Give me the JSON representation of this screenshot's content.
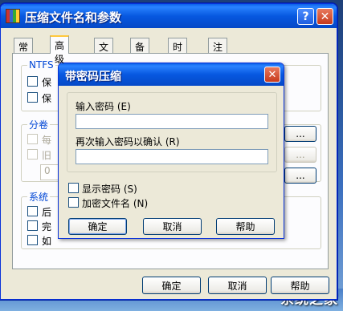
{
  "window": {
    "title": "压缩文件名和参数",
    "help_label": "?",
    "close_label": "✕"
  },
  "tabs": [
    "常规",
    "高级",
    "文件",
    "备份",
    "时间",
    "注释"
  ],
  "active_tab": "高级",
  "advanced": {
    "ntfs_group": "NTFS",
    "ntfs_options": [
      "保",
      "保"
    ],
    "volume_group": "分卷",
    "volume_options": [
      "每",
      "旧"
    ],
    "volume_value": "0",
    "system_group": "系统",
    "system_options": [
      "后",
      "完",
      "如"
    ],
    "side_buttons": [
      "...",
      "...",
      "..."
    ]
  },
  "bottom_buttons": {
    "ok": "确定",
    "cancel": "取消",
    "help": "帮助"
  },
  "dialog": {
    "title": "带密码压缩",
    "close_label": "✕",
    "password_label": "输入密码 (E)",
    "password_value": "",
    "confirm_label": "再次输入密码以确认 (R)",
    "confirm_value": "",
    "show_password_label": "显示密码 (S)",
    "show_password_checked": false,
    "encrypt_names_label": "加密文件名 (N)",
    "encrypt_names_checked": false,
    "ok_label": "确定",
    "cancel_label": "取消",
    "help_label": "帮助"
  },
  "watermark": "系统之家"
}
